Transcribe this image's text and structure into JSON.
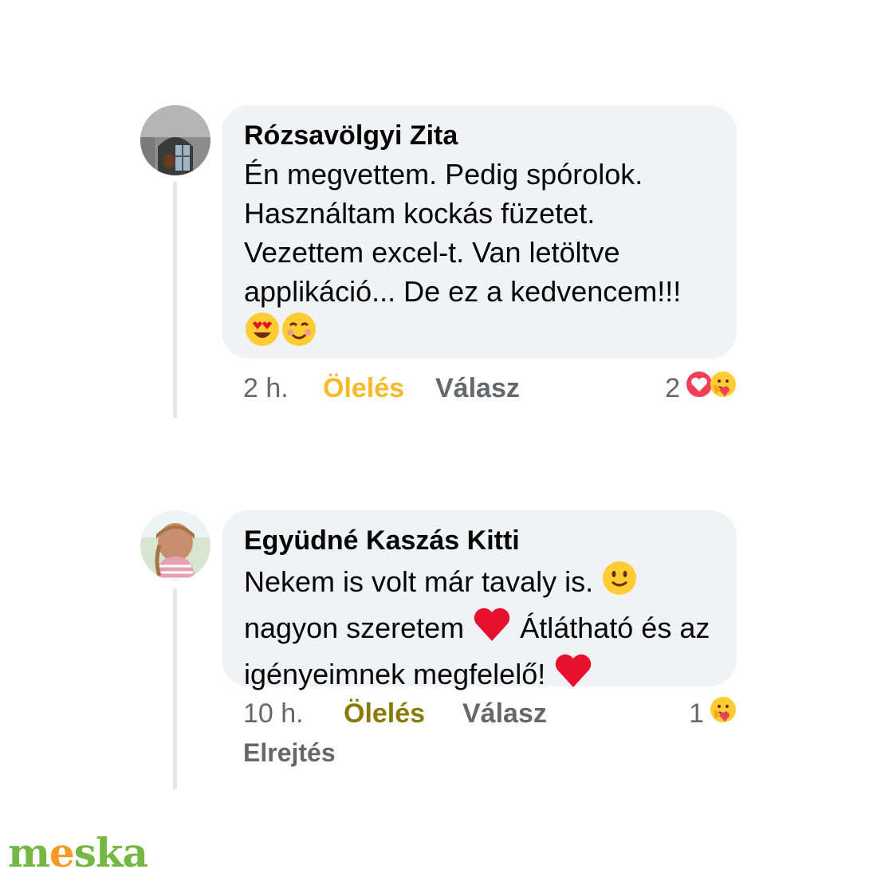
{
  "comments": [
    {
      "author": "Rózsavölgyi Zita",
      "text": "Én megvettem. Pedig spórolok. Használtam kockás füzetet. Vezettem excel-t. Van letöltve applikáció... De ez a kedvencem!!!",
      "time": "2 h.",
      "hug_label": "Ölelés",
      "reply_label": "Válasz",
      "reaction_count": "2",
      "reaction_icons": [
        "heart-reaction",
        "care-reaction"
      ],
      "emojis": [
        "heart-eyes-emoji",
        "smiling-emoji"
      ]
    },
    {
      "author": "Együdné Kaszás Kitti",
      "text_part1": "Nekem is volt már tavaly is.",
      "text_part2": "nagyon szeretem",
      "text_part3": "Átlátható és az igényeimnek megfelelő!",
      "time": "10 h.",
      "hug_label": "Ölelés",
      "reply_label": "Válasz",
      "hide_label": "Elrejtés",
      "reaction_count": "1",
      "reaction_icons": [
        "care-reaction"
      ],
      "emojis": [
        "slight-smile-emoji",
        "red-heart-emoji",
        "red-heart-emoji"
      ]
    }
  ],
  "brand": {
    "logo_m": "m",
    "logo_e": "e",
    "logo_ska": "ska"
  },
  "colors": {
    "bubble": "#f0f2f5",
    "hug_active": "#f7b928",
    "brand_green": "#74b843",
    "brand_orange": "#f59b23"
  }
}
